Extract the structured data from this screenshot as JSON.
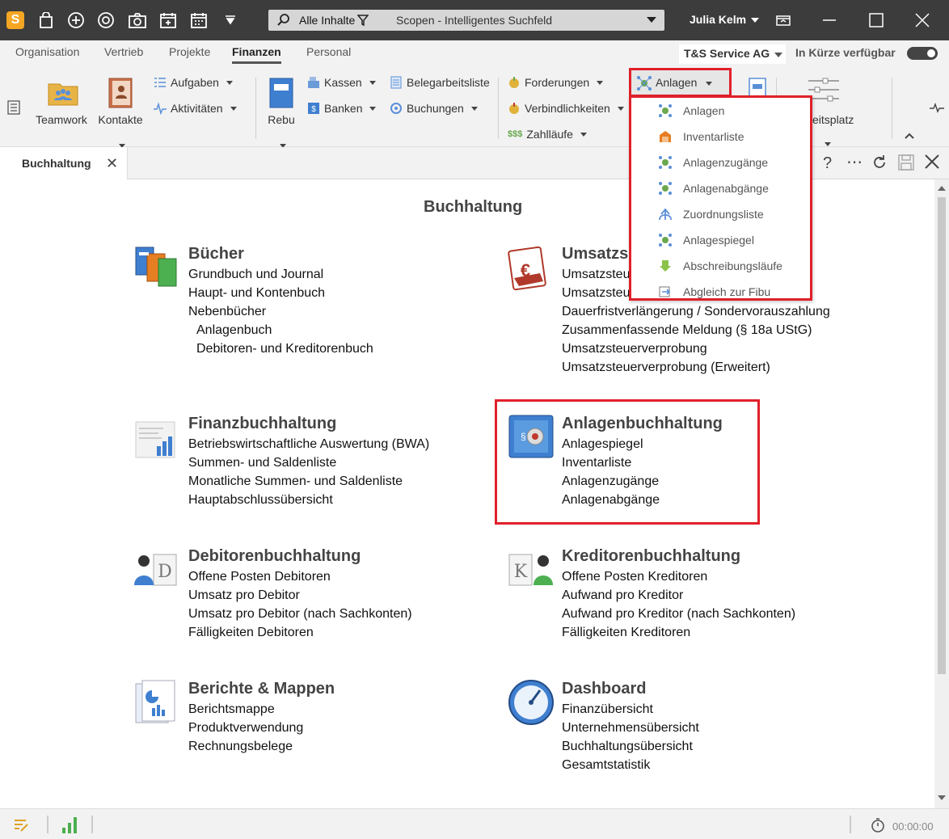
{
  "titlebar": {
    "search_scope": "Alle Inhalte",
    "search_placeholder": "Scopen - Intelligentes Suchfeld",
    "user_name": "Julia Kelm"
  },
  "menubar": {
    "tabs": [
      "Organisation",
      "Vertrieb",
      "Projekte",
      "Finanzen",
      "Personal"
    ],
    "active_tab": "Finanzen",
    "company": "T&S Service AG",
    "soon_label": "In Kürze verfügbar"
  },
  "ribbon": {
    "teamwork": "Teamwork",
    "kontakte": "Kontakte",
    "aufgaben": "Aufgaben",
    "aktivitaeten": "Aktivitäten",
    "rebu": "Rebu",
    "kassen": "Kassen",
    "banken": "Banken",
    "belegarbeitsliste": "Belegarbeitsliste",
    "buchungen": "Buchungen",
    "forderungen": "Forderungen",
    "verbindlichkeiten": "Verbindlichkeiten",
    "zahllaeufe": "Zahlläufe",
    "anlagen": "Anlagen",
    "arbeitsplatz_partial": "eitsplatz"
  },
  "anlagen_menu": [
    {
      "label": "Anlagen",
      "icon": "asset-network-icon"
    },
    {
      "label": "Inventarliste",
      "icon": "inventory-icon"
    },
    {
      "label": "Anlagenzugänge",
      "icon": "asset-network-icon"
    },
    {
      "label": "Anlagenabgänge",
      "icon": "asset-network-icon"
    },
    {
      "label": "Zuordnungsliste",
      "icon": "assignment-arrow-icon"
    },
    {
      "label": "Anlagespiegel",
      "icon": "asset-network-icon"
    },
    {
      "label": "Abschreibungsläufe",
      "icon": "depreciation-icon"
    },
    {
      "label": "Abgleich zur Fibu",
      "icon": "sync-icon"
    }
  ],
  "doc_tab": {
    "label": "Buchhaltung"
  },
  "content": {
    "title": "Buchhaltung",
    "sections": {
      "buecher": {
        "title": "Bücher",
        "links": [
          "Grundbuch und Journal",
          "Haupt- und Kontenbuch",
          "Nebenbücher",
          "Anlagenbuch",
          "Debitoren- und Kreditorenbuch"
        ]
      },
      "umsatzsteuer": {
        "title": "Umsatzs",
        "links": [
          "Umsatzsteu",
          "Umsatzsteu",
          "Dauerfristverlängerung / Sondervorauszahlung",
          "Zusammenfassende Meldung (§ 18a UStG)",
          "Umsatzsteuerverprobung",
          "Umsatzsteuerverprobung (Erweitert)"
        ]
      },
      "finanzbuchhaltung": {
        "title": "Finanzbuchhaltung",
        "links": [
          "Betriebswirtschaftliche Auswertung (BWA)",
          "Summen- und Saldenliste",
          "Monatliche Summen- und Saldenliste",
          "Hauptabschlussübersicht"
        ]
      },
      "anlagenbuchhaltung": {
        "title": "Anlagenbuchhaltung",
        "links": [
          "Anlagespiegel",
          "Inventarliste",
          "Anlagenzugänge",
          "Anlagenabgänge"
        ]
      },
      "debitoren": {
        "title": "Debitorenbuchhaltung",
        "links": [
          "Offene Posten Debitoren",
          "Umsatz pro Debitor",
          "Umsatz pro Debitor (nach Sachkonten)",
          "Fälligkeiten Debitoren"
        ]
      },
      "kreditoren": {
        "title": "Kreditorenbuchhaltung",
        "links": [
          "Offene Posten Kreditoren",
          "Aufwand pro Kreditor",
          "Aufwand pro Kreditor (nach Sachkonten)",
          "Fälligkeiten Kreditoren"
        ]
      },
      "berichte": {
        "title": "Berichte & Mappen",
        "links": [
          "Berichtsmappe",
          "Produktverwendung",
          "Rechnungsbelege"
        ]
      },
      "dashboard": {
        "title": "Dashboard",
        "links": [
          "Finanzübersicht",
          "Unternehmensübersicht",
          "Buchhaltungsübersicht",
          "Gesamtstatistik"
        ]
      }
    }
  },
  "statusbar": {
    "timer": "00:00:00"
  },
  "colors": {
    "highlight": "#e0202a",
    "titlebar": "#3c3c3c",
    "logo": "#f5a623"
  }
}
